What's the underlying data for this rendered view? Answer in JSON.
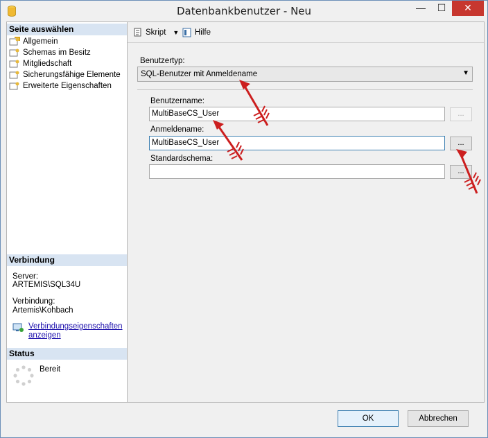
{
  "window": {
    "title": "Datenbankbenutzer - Neu"
  },
  "titlebar": {
    "minimize_icon": "minimize-icon",
    "maximize_icon": "maximize-icon",
    "close_icon": "close-icon",
    "min_glyph": "—",
    "max_glyph": "☐",
    "close_glyph": "✕"
  },
  "left": {
    "page_header": "Seite auswählen",
    "pages": [
      {
        "label": "Allgemein",
        "selected": true
      },
      {
        "label": "Schemas im Besitz",
        "selected": false
      },
      {
        "label": "Mitgliedschaft",
        "selected": false
      },
      {
        "label": "Sicherungsfähige Elemente",
        "selected": false
      },
      {
        "label": "Erweiterte Eigenschaften",
        "selected": false
      }
    ],
    "connection_header": "Verbindung",
    "server_label": "Server:",
    "server_value": "ARTEMIS\\SQL34U",
    "connection_label": "Verbindung:",
    "connection_value": "Artemis\\Kohbach",
    "connection_link_line1": "Verbindungseigenschaften",
    "connection_link_line2": "anzeigen",
    "status_header": "Status",
    "status_value": "Bereit"
  },
  "toolbar": {
    "script_label": "Skript",
    "help_label": "Hilfe"
  },
  "form": {
    "user_type_label": "Benutzertyp:",
    "user_type_value": "SQL-Benutzer mit Anmeldename",
    "username_label": "Benutzername:",
    "username_value": "MultiBaseCS_User",
    "login_label": "Anmeldename:",
    "login_value": "MultiBaseCS_User",
    "default_schema_label": "Standardschema:",
    "default_schema_value": "",
    "browse_label": "..."
  },
  "buttons": {
    "ok": "OK",
    "cancel": "Abbrechen"
  },
  "colors": {
    "accent": "#3c7fb1",
    "section_header": "#d8e4f2",
    "close": "#c7372f",
    "arrow": "#cc1f1f"
  }
}
